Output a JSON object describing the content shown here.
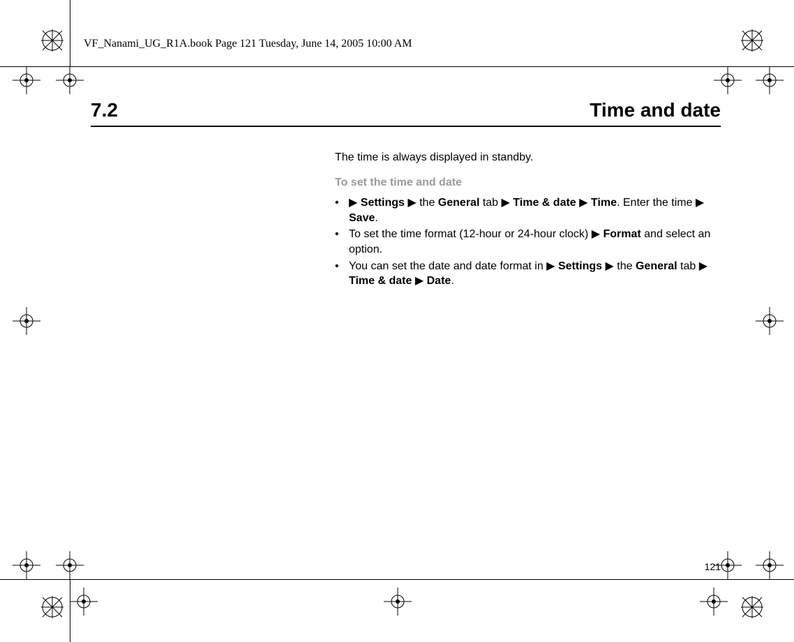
{
  "book_header": "VF_Nanami_UG_R1A.book  Page 121  Tuesday, June 14, 2005  10:00 AM",
  "heading": {
    "number": "7.2",
    "title": "Time and date"
  },
  "intro": "The time is always displayed in standby.",
  "subhead": "To set the time and date",
  "arrow": "▶",
  "bullets": {
    "b1": {
      "settings": "Settings",
      "the": " the ",
      "general": "General",
      "tab": " tab ",
      "timedate": "Time & date",
      "time": "Time",
      "enter": ". Enter the time ",
      "save": "Save",
      "dot": "."
    },
    "b2": {
      "pre": "To set the time format (12-hour or 24-hour clock) ",
      "format": "Format",
      "post": " and select an option."
    },
    "b3": {
      "pre": "You can set the date and date format in  ",
      "settings": "Settings",
      "the": " the ",
      "general": "General",
      "tab": " tab ",
      "timedate": "Time & date",
      "date": "Date",
      "dot": "."
    }
  },
  "page_number": "121"
}
